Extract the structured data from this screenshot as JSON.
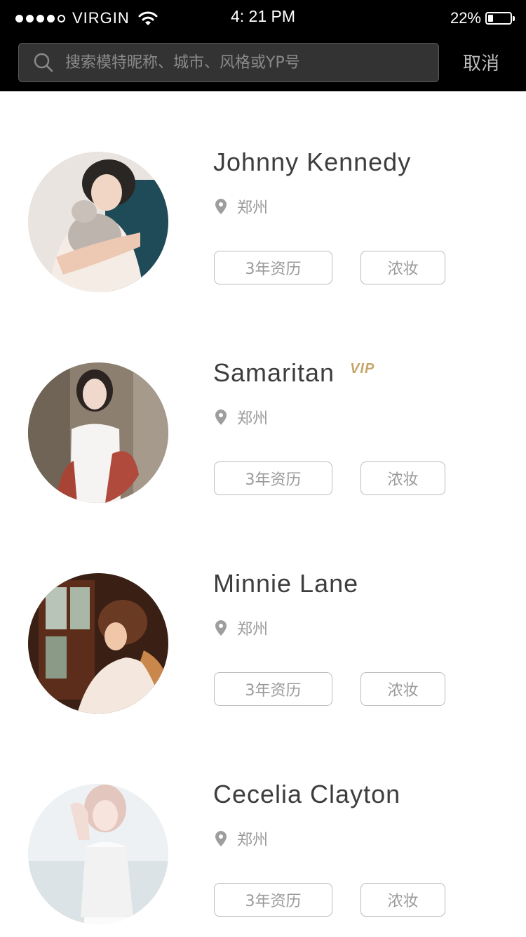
{
  "status_bar": {
    "carrier": "VIRGIN",
    "time": "4: 21 PM",
    "battery_text": "22%",
    "battery_level": 0.22
  },
  "search": {
    "placeholder": "搜索模特昵称、城市、风格或YP号",
    "value": "",
    "cancel_label": "取消"
  },
  "icons": {
    "search": "search-icon",
    "location": "location-pin-icon",
    "wifi": "wifi-icon",
    "battery": "battery-icon",
    "signal": "signal-dots-icon"
  },
  "colors": {
    "header_bg": "#000000",
    "name_text": "#3d3d3d",
    "muted_text": "#9a9a9a",
    "vip_gold": "#c5a56a",
    "tag_border": "#bcbcbc"
  },
  "models": [
    {
      "name": "Johnny Kennedy",
      "vip": "",
      "city": "郑州",
      "tags": [
        "3年资历",
        "浓妆"
      ]
    },
    {
      "name": "Samaritan",
      "vip": "VIP",
      "city": "郑州",
      "tags": [
        "3年资历",
        "浓妆"
      ]
    },
    {
      "name": "Minnie Lane",
      "vip": "",
      "city": "郑州",
      "tags": [
        "3年资历",
        "浓妆"
      ]
    },
    {
      "name": "Cecelia Clayton",
      "vip": "",
      "city": "郑州",
      "tags": [
        "3年资历",
        "浓妆"
      ]
    }
  ]
}
